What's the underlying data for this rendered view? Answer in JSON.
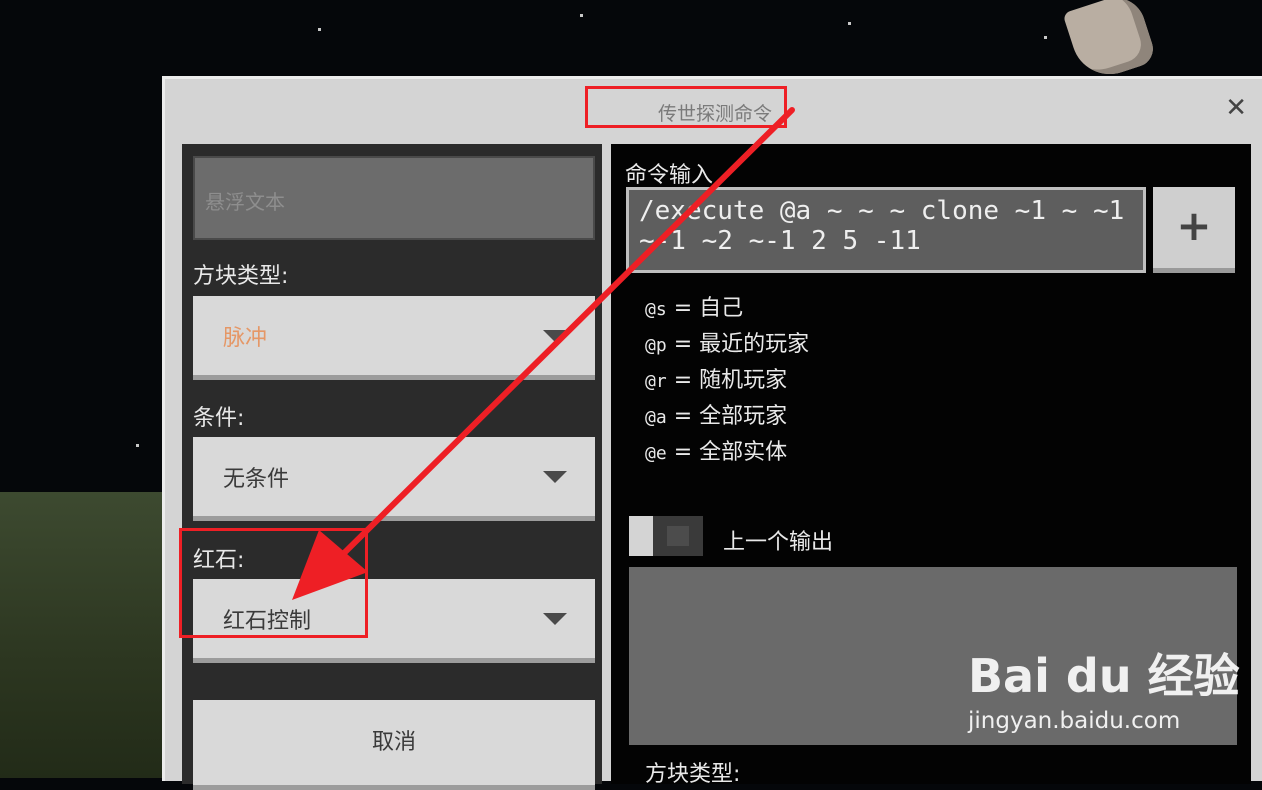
{
  "dialog": {
    "title": "传世探测命令",
    "close_label": "✕"
  },
  "left_panel": {
    "hover_text_placeholder": "悬浮文本",
    "block_type_label": "方块类型:",
    "block_type_value": "脉冲",
    "condition_label": "条件:",
    "condition_value": "无条件",
    "redstone_label": "红石:",
    "redstone_value": "红石控制",
    "cancel_label": "取消"
  },
  "right_panel": {
    "command_input_label": "命令输入",
    "command_value": "/execute @a ~ ~ ~ clone ~1 ~ ~1 ~-1 ~2 ~-1 2 5 -11",
    "add_button_label": "+",
    "selectors": [
      {
        "code": "@s",
        "desc": "= 自己"
      },
      {
        "code": "@p",
        "desc": "= 最近的玩家"
      },
      {
        "code": "@r",
        "desc": "= 随机玩家"
      },
      {
        "code": "@a",
        "desc": "= 全部玩家"
      },
      {
        "code": "@e",
        "desc": "= 全部实体"
      }
    ],
    "previous_output_label": "上一个输出",
    "previous_output_value": "",
    "bottom_block_type_label": "方块类型:"
  },
  "watermark": {
    "logo": "Bai du 经验",
    "url": "jingyan.baidu.com"
  },
  "colors": {
    "annotation": "#ee1f25",
    "dialog_bg": "#d4d4d4",
    "input_bg": "#6c6c6c"
  }
}
